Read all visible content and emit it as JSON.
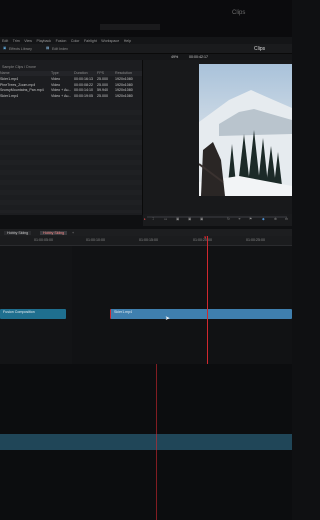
{
  "app": {
    "title": "Clips",
    "window_title": "Sample Clips / Drone"
  },
  "menu": [
    "Edit",
    "Trim",
    "View",
    "Playback",
    "Fusion",
    "Color",
    "Fairlight",
    "Workspace",
    "Help"
  ],
  "toolbar": {
    "media_pool_label": "Effects Library",
    "edit_index_label": "Edit Index",
    "viewer_title": "Clips",
    "zoom": "49%",
    "timecode": "00:00:42:17"
  },
  "media_pool": {
    "bin_path": "Sample Clips / Drone",
    "columns": [
      "Name",
      "Type",
      "Duration",
      "FPS",
      "Resolution"
    ],
    "rows": [
      {
        "name": "Skier1.mp4",
        "type": "Video",
        "duration": "00:00:16:13",
        "fps": "25.000",
        "resolution": "1920x1080"
      },
      {
        "name": "PineTrees_Zoom.mp4",
        "type": "Video",
        "duration": "00:00:08:22",
        "fps": "25.000",
        "resolution": "1920x1080"
      },
      {
        "name": "SnowyMountains_Pan.mp4",
        "type": "Video + Au...",
        "duration": "00:00:14:10",
        "fps": "59.940",
        "resolution": "1920x1080"
      },
      {
        "name": "Skier1.mp4",
        "type": "Video + Au...",
        "duration": "00:00:19:05",
        "fps": "25.000",
        "resolution": "1920x1080"
      }
    ]
  },
  "timeline": {
    "tabs": [
      "Hobby Skiing",
      "Hobby Skiing"
    ],
    "ruler_labels": [
      "01:00:05:00",
      "01:00:10:00",
      "01:00:15:00",
      "01:00:20:00",
      "01:00:25:00"
    ],
    "clips": [
      {
        "label": "Fusion Composition",
        "color": "#1f6f8f"
      },
      {
        "label": "Skier1.mp4",
        "color": "#3f7fae"
      }
    ]
  },
  "colors": {
    "playhead": "#d0282e",
    "accent": "#3f7fae"
  }
}
